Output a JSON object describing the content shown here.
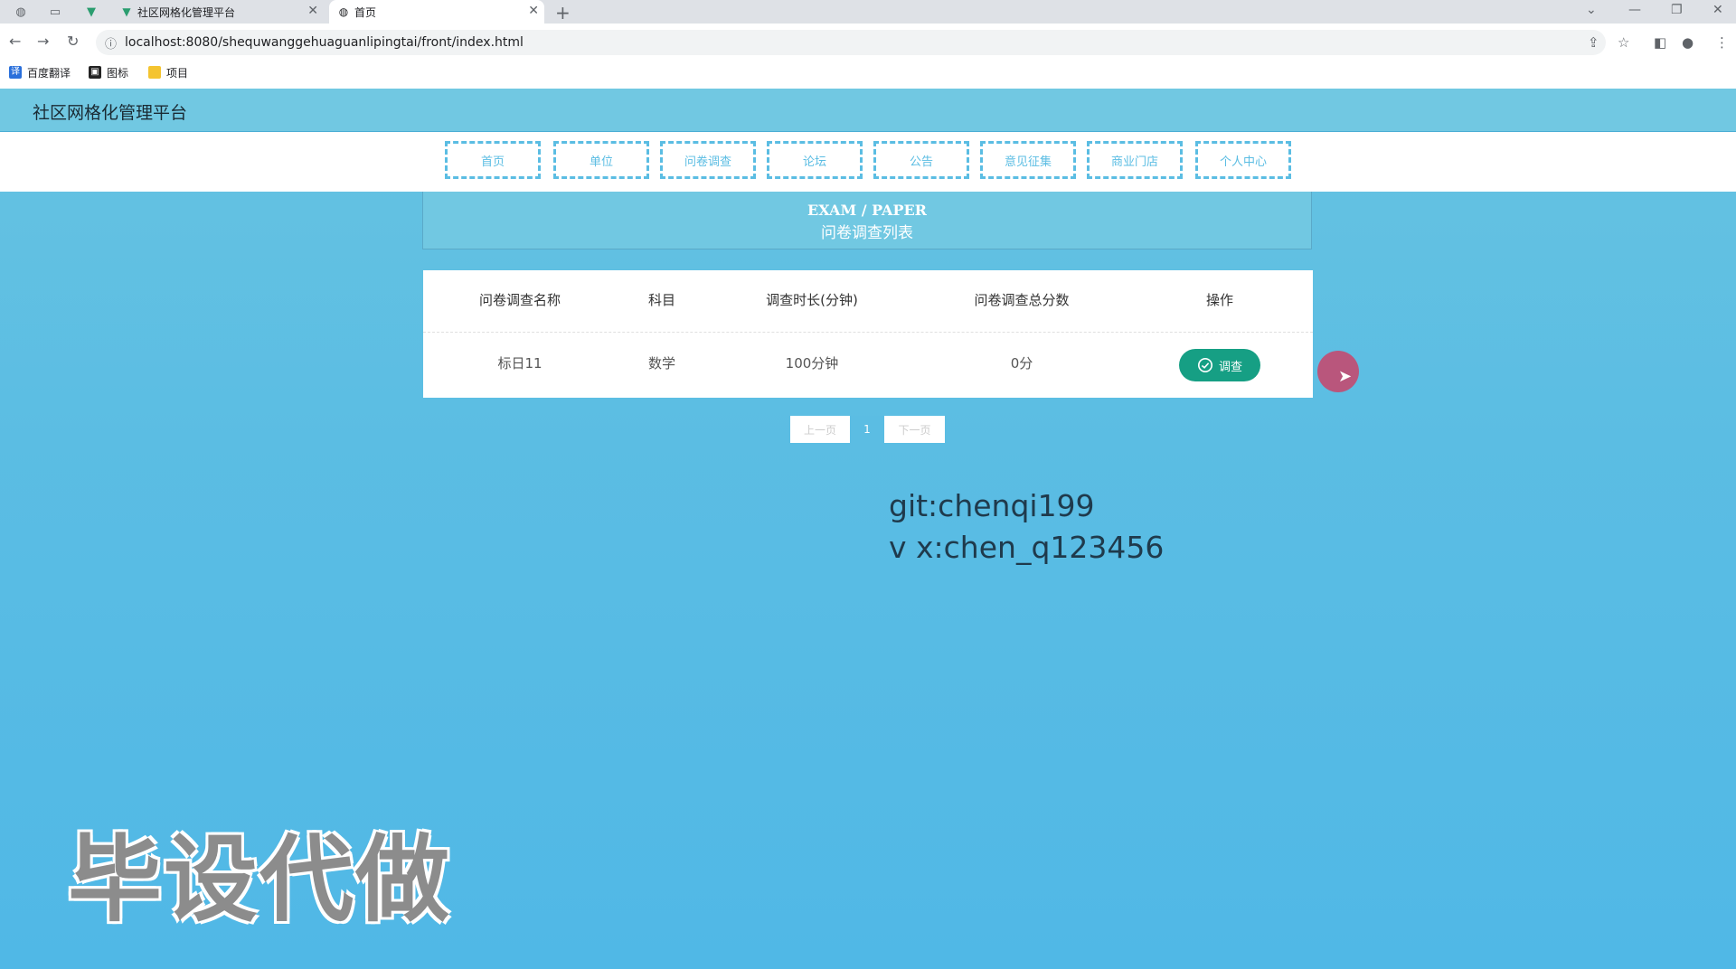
{
  "browser": {
    "tabs": [
      {
        "title": "社区网格化管理平台",
        "active": false
      },
      {
        "title": "首页",
        "active": true
      }
    ],
    "new_tab": "+",
    "url": "localhost:8080/shequwanggehuaguanlipingtai/front/index.html",
    "bookmarks": [
      "百度翻译",
      "图标",
      "项目"
    ]
  },
  "site": {
    "title": "社区网格化管理平台",
    "menu": [
      "首页",
      "单位",
      "问卷调查",
      "论坛",
      "公告",
      "意见征集",
      "商业门店",
      "个人中心"
    ],
    "panel_en": "EXAM / PAPER",
    "panel_cn": "问卷调查列表",
    "table": {
      "headers": [
        "问卷调查名称",
        "科目",
        "调查时长(分钟)",
        "问卷调查总分数",
        "操作"
      ],
      "rows": [
        {
          "name": "标日11",
          "subject": "数学",
          "duration": "100分钟",
          "score": "0分",
          "action": "调查"
        }
      ]
    },
    "pager": {
      "prev": "上一页",
      "current": "1",
      "next": "下一页"
    }
  },
  "overlay": {
    "line1": "git:chenqi199",
    "line2": "v x:chen_q123456",
    "watermark": "毕设代做"
  },
  "colors": {
    "accent": "#5bbde3",
    "button": "#169f84",
    "header": "#71c8e2"
  }
}
